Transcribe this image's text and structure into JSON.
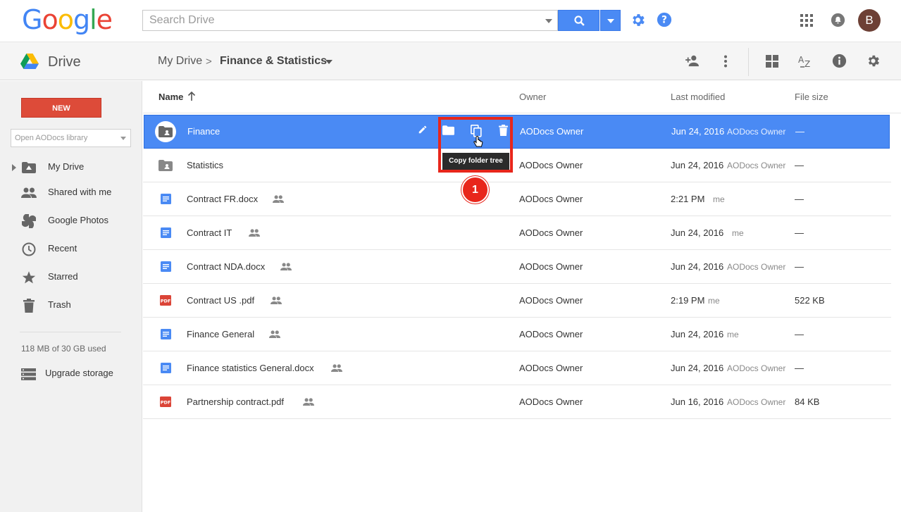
{
  "header": {
    "logo_text": "Google",
    "search_placeholder": "Search Drive",
    "avatar_initial": "B",
    "colors": {
      "accent": "#4a8af4",
      "new_button": "#dd4b39",
      "highlight": "#e8261b"
    }
  },
  "toolbar": {
    "app_name": "Drive",
    "breadcrumb_root": "My Drive",
    "breadcrumb_sep": ">",
    "breadcrumb_current": "Finance & Statistics"
  },
  "sidebar": {
    "new_label": "NEW",
    "library_placeholder": "Open AODocs library",
    "items": [
      {
        "label": "My Drive",
        "icon": "my-drive-icon"
      },
      {
        "label": "Shared with me",
        "icon": "people-icon"
      },
      {
        "label": "Google Photos",
        "icon": "photos-icon"
      },
      {
        "label": "Recent",
        "icon": "clock-icon"
      },
      {
        "label": "Starred",
        "icon": "star-icon"
      },
      {
        "label": "Trash",
        "icon": "trash-icon"
      }
    ],
    "storage_text": "118 MB of 30 GB used",
    "upgrade_label": "Upgrade storage"
  },
  "list": {
    "columns": {
      "name": "Name",
      "owner": "Owner",
      "modified": "Last modified",
      "size": "File size"
    },
    "rows": [
      {
        "name": "Finance",
        "type": "shared-folder",
        "owner": "AODocs Owner",
        "modified": "Jun 24, 2016",
        "by": "AODocs Owner",
        "size": "—",
        "shared": false,
        "selected": true
      },
      {
        "name": "Statistics",
        "type": "shared-folder",
        "owner": "AODocs Owner",
        "modified": "Jun 24, 2016",
        "by": "AODocs Owner",
        "size": "—",
        "shared": false
      },
      {
        "name": "Contract FR.docx",
        "type": "doc",
        "owner": "AODocs Owner",
        "modified": "2:21 PM",
        "by": "me",
        "size": "—",
        "shared": true
      },
      {
        "name": "Contract IT",
        "type": "doc",
        "owner": "AODocs Owner",
        "modified": "Jun 24, 2016",
        "by": "me",
        "size": "—",
        "shared": true
      },
      {
        "name": "Contract NDA.docx",
        "type": "doc",
        "owner": "AODocs Owner",
        "modified": "Jun 24, 2016",
        "by": "AODocs Owner",
        "size": "—",
        "shared": true
      },
      {
        "name": "Contract US .pdf",
        "type": "pdf",
        "owner": "AODocs Owner",
        "modified": "2:19 PM",
        "by": "me",
        "size": "522 KB",
        "shared": true
      },
      {
        "name": "Finance General",
        "type": "doc",
        "owner": "AODocs Owner",
        "modified": "Jun 24, 2016",
        "by": "me",
        "size": "—",
        "shared": true
      },
      {
        "name": "Finance statistics General.docx",
        "type": "doc",
        "owner": "AODocs Owner",
        "modified": "Jun 24, 2016",
        "by": "AODocs Owner",
        "size": "—",
        "shared": true
      },
      {
        "name": "Partnership contract.pdf",
        "type": "pdf",
        "owner": "AODocs Owner",
        "modified": "Jun 16, 2016",
        "by": "AODocs Owner",
        "size": "84 KB",
        "shared": true
      }
    ]
  },
  "row_actions": {
    "tooltip": "Copy folder tree",
    "pdf_label": "PDF"
  },
  "annotation": {
    "step_number": "1"
  }
}
